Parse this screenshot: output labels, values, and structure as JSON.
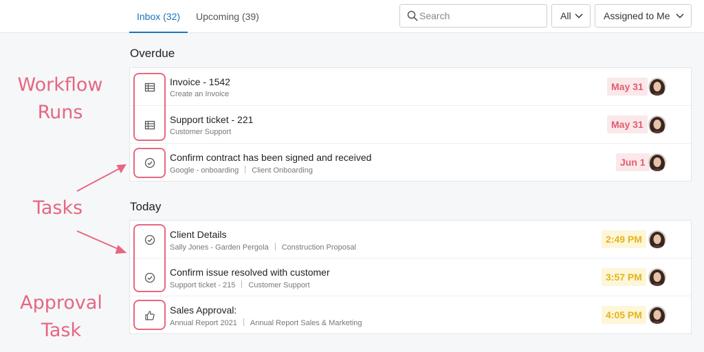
{
  "tabs": [
    {
      "label": "Inbox (32)",
      "active": true
    },
    {
      "label": "Upcoming (39)",
      "active": false
    }
  ],
  "search": {
    "placeholder": "Search",
    "value": ""
  },
  "filters": {
    "all_label": "All",
    "assigned_label": "Assigned to Me"
  },
  "sections": {
    "overdue": {
      "title": "Overdue",
      "rows": [
        {
          "icon": "table-icon",
          "title": "Invoice - 1542",
          "sub": [
            "Create an Invoice"
          ],
          "due": "May 31"
        },
        {
          "icon": "table-icon",
          "title": "Support ticket - 221",
          "sub": [
            "Customer Support"
          ],
          "due": "May 31"
        },
        {
          "icon": "check-circle-icon",
          "title": "Confirm contract has been signed and received",
          "sub": [
            "Google - onboarding",
            "Client Onboarding"
          ],
          "due": "Jun 1"
        }
      ]
    },
    "today": {
      "title": "Today",
      "rows": [
        {
          "icon": "check-circle-icon",
          "title": "Client Details",
          "sub": [
            "Sally Jones - Garden Pergola",
            "Construction Proposal"
          ],
          "due": "2:49 PM"
        },
        {
          "icon": "check-circle-icon",
          "title": "Confirm issue resolved with customer",
          "sub": [
            "Support ticket - 215",
            "Customer Support"
          ],
          "due": "3:57 PM"
        },
        {
          "icon": "thumbs-up-icon",
          "title": "Sales Approval:",
          "sub": [
            "Annual Report 2021",
            "Annual Report Sales & Marketing"
          ],
          "due": "4:05 PM"
        }
      ]
    }
  },
  "annotations": {
    "workflow_line1": "Workflow",
    "workflow_line2": "Runs",
    "tasks": "Tasks",
    "approval_line1": "Approval",
    "approval_line2": "Task"
  },
  "colors": {
    "accent": "#1a73b9",
    "overdue": "#e25c6e",
    "today": "#e6b31a",
    "annotation": "#e6677f"
  }
}
